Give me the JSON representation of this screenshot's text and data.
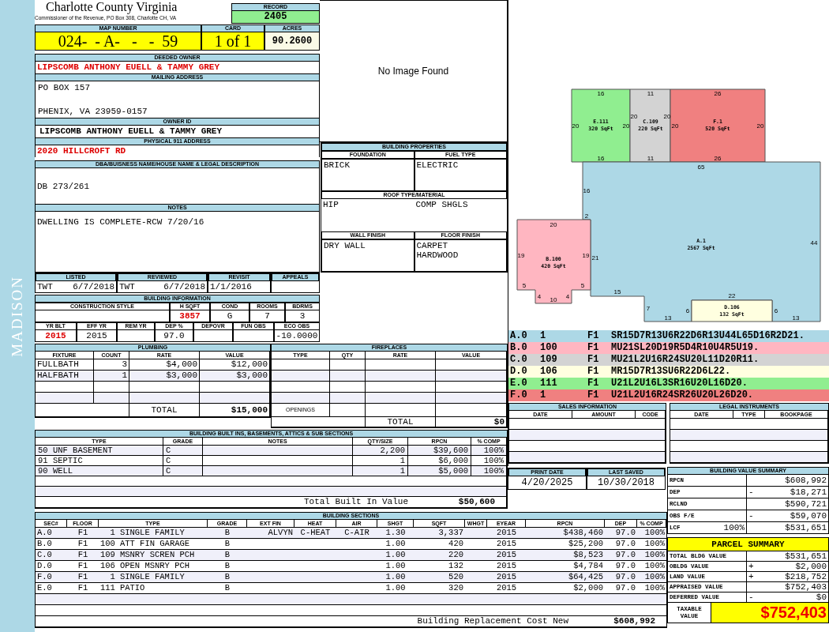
{
  "sidebar": {
    "label": "MADISON"
  },
  "header": {
    "title": "Charlotte County Virginia",
    "subtitle": "Commissioner of the Revenue, PO Box 308, Charlotte CH, VA"
  },
  "record": {
    "label": "RECORD",
    "value": "2405"
  },
  "map_number": {
    "label": "MAP NUMBER",
    "value": "024-  - A-   -   -  59"
  },
  "card": {
    "label": "CARD",
    "value": "1 of 1"
  },
  "acres": {
    "label": "ACRES",
    "value": "90.2600"
  },
  "deeded_owner": {
    "label": "DEEDED OWNER",
    "value": "LIPSCOMB ANTHONY EUELL & TAMMY GREY"
  },
  "mailing_address": {
    "label": "MAILING ADDRESS",
    "lines": [
      "PO BOX 157",
      "PHENIX, VA 23959-0157"
    ]
  },
  "owner_id": {
    "label": "OWNER ID",
    "value": "LIPSCOMB ANTHONY EUELL & TAMMY GREY"
  },
  "physical_address": {
    "label": "PHYSICAL 911 ADDRESS",
    "value": "2020 HILLCROFT RD"
  },
  "legal_description": {
    "label": "DBA/BUISNESS NAME/HOUSE NAME & LEGAL DESCRIPTION",
    "value": "DB 273/261"
  },
  "notes": {
    "label": "NOTES",
    "value": "DWELLING IS COMPLETE-RCW 7/20/16"
  },
  "photo": {
    "message": "No Image Found"
  },
  "building_properties": {
    "title": "BUILDING PROPERTIES",
    "foundation": {
      "label": "FOUNDATION",
      "value": "BRICK"
    },
    "fuel_type": {
      "label": "FUEL TYPE",
      "value": "ELECTRIC"
    },
    "roof": {
      "label": "ROOF TYPE/MATERIAL",
      "values": [
        "HIP",
        "COMP SHGLS"
      ]
    },
    "wall_finish": {
      "label": "WALL FINISH",
      "value": "DRY WALL"
    },
    "floor_finish": {
      "label": "FLOOR FINISH",
      "lines": [
        "CARPET",
        "HARDWOOD"
      ]
    }
  },
  "review": [
    {
      "label": "LISTED",
      "values": [
        "TWT",
        "6/7/2018"
      ]
    },
    {
      "label": "REVIEWED",
      "values": [
        "TWT",
        "6/7/2018"
      ]
    },
    {
      "label": "REVISIT",
      "values": [
        "1/1/2016"
      ]
    },
    {
      "label": "APPEALS"
    }
  ],
  "building_information": {
    "title": "BUILDING INFORMATION",
    "row1": [
      {
        "label": "CONSTRUCTION STYLE"
      },
      {
        "label": "H SQFT",
        "value": "3857",
        "highlight": true
      },
      {
        "label": "COND",
        "value": "G",
        "highlight": false
      },
      {
        "label": "ROOMS",
        "value": "7",
        "highlight": false
      },
      {
        "label": "BDRMS",
        "value": "3",
        "highlight": false
      }
    ],
    "row2": [
      {
        "label": "YR BLT",
        "value": "2015",
        "highlight": true
      },
      {
        "label": "EFF YR",
        "value": "2015",
        "highlight": false
      },
      {
        "label": "REM YR"
      },
      {
        "label": "DEP %",
        "value": "97.0",
        "highlight": false
      },
      {
        "label": "DEPOVR"
      },
      {
        "label": "FUN OBS"
      },
      {
        "label": "ECO OBS",
        "value": "-10.0000",
        "highlight": false
      }
    ]
  },
  "plumbing": {
    "title": "PLUMBING",
    "columns": [
      "FIXTURE",
      "COUNT",
      "RATE",
      "VALUE"
    ],
    "rows": [
      {
        "fixture": "FULLBATH",
        "count": "3",
        "rate": "$4,000",
        "value": "$12,000"
      },
      {
        "fixture": "HALFBATH",
        "count": "1",
        "rate": "$3,000",
        "value": "$3,000"
      }
    ],
    "total_label": "TOTAL",
    "total": "$15,000"
  },
  "fireplaces": {
    "title": "FIREPLACES",
    "columns": [
      "TYPE",
      "QTY",
      "RATE",
      "VALUE"
    ],
    "openings_label": "OPENINGS",
    "total_label": "TOTAL",
    "total": "$0"
  },
  "built_ins": {
    "title": "BUILDING BUILT INS, BASEMENTS, ATTICS & SUB SECTIONS",
    "columns": [
      "TYPE",
      "GRADE",
      "NOTES",
      "QTY/SIZE",
      "RPCN",
      "% COMP"
    ],
    "rows": [
      {
        "type": "50 UNF BASEMENT",
        "grade": "C",
        "qty": "2,200",
        "rpcn": "$39,600",
        "comp": "100%"
      },
      {
        "type": "91 SEPTIC",
        "grade": "C",
        "qty": "1",
        "rpcn": "$6,000",
        "comp": "100%"
      },
      {
        "type": "90 WELL",
        "grade": "C",
        "qty": "1",
        "rpcn": "$5,000",
        "comp": "100%"
      }
    ],
    "total_label": "Total Built In Value",
    "total": "$50,600"
  },
  "building_sections": {
    "title": "BUILDING SECTIONS",
    "columns": [
      "SEC#",
      "FLOOR",
      "TYPE",
      "GRADE",
      "EXT FIN",
      "HEAT",
      "AIR",
      "SHGT",
      "SQFT",
      "WHGT",
      "EYEAR",
      "RPCN",
      "DEP",
      "% COMP"
    ],
    "rows": [
      {
        "sec": "A.0",
        "floor": "F1",
        "code": "1",
        "type": "SINGLE FAMILY",
        "grade": "B",
        "ext_fin": "ALVYN",
        "heat": "C-HEAT",
        "air": "C-AIR",
        "shgt": "1.30",
        "sqft": "3,337",
        "eyear": "2015",
        "rpcn": "$438,460",
        "dep": "97.0",
        "comp": "100%"
      },
      {
        "sec": "B.0",
        "floor": "F1",
        "code": "100",
        "type": "ATT FIN GARAGE",
        "grade": "B",
        "shgt": "1.00",
        "sqft": "420",
        "eyear": "2015",
        "rpcn": "$25,200",
        "dep": "97.0",
        "comp": "100%"
      },
      {
        "sec": "C.0",
        "floor": "F1",
        "code": "109",
        "type": "MSNRY SCREN PCH",
        "grade": "B",
        "shgt": "1.00",
        "sqft": "220",
        "eyear": "2015",
        "rpcn": "$8,523",
        "dep": "97.0",
        "comp": "100%"
      },
      {
        "sec": "D.0",
        "floor": "F1",
        "code": "106",
        "type": "OPEN MSNRY PCH",
        "grade": "B",
        "shgt": "1.00",
        "sqft": "132",
        "eyear": "2015",
        "rpcn": "$4,784",
        "dep": "97.0",
        "comp": "100%"
      },
      {
        "sec": "F.0",
        "floor": "F1",
        "code": "1",
        "type": "SINGLE FAMILY",
        "grade": "B",
        "shgt": "1.00",
        "sqft": "520",
        "eyear": "2015",
        "rpcn": "$64,425",
        "dep": "97.0",
        "comp": "100%"
      },
      {
        "sec": "E.0",
        "floor": "F1",
        "code": "111",
        "type": "PATIO",
        "grade": "B",
        "shgt": "1.00",
        "sqft": "320",
        "eyear": "2015",
        "rpcn": "$2,000",
        "dep": "97.0",
        "comp": "100%"
      }
    ],
    "total_label": "Building Replacement Cost New",
    "total": "$608,992"
  },
  "sketch": {
    "areas": [
      {
        "label": "E.111",
        "sqft": "320 SqFt",
        "color": "#90ee90",
        "dims": [
          "16",
          "16",
          "20",
          "20"
        ]
      },
      {
        "label": "C.109",
        "sqft": "220 SqFt",
        "color": "#d3d3d3",
        "dims": [
          "11",
          "11",
          "20",
          "20"
        ]
      },
      {
        "label": "F.1",
        "sqft": "520 SqFt",
        "color": "#f08080",
        "dims": [
          "26",
          "26",
          "20",
          "20"
        ]
      },
      {
        "label": "A.1",
        "sqft": "2567 SqFt",
        "color": "#add8e6",
        "dims": [
          "65",
          "16",
          "2",
          "21",
          "15",
          "7",
          "13",
          "6",
          "22",
          "6",
          "13",
          "44"
        ]
      },
      {
        "label": "B.100",
        "sqft": "420 SqFt",
        "color": "#ffb6c1",
        "dims": [
          "20",
          "19",
          "19",
          "5",
          "4",
          "10",
          "4",
          "5"
        ]
      },
      {
        "label": "D.106",
        "sqft": "132 SqFt",
        "color": "#ffffe0"
      }
    ]
  },
  "segments": [
    {
      "sec": "A.0",
      "code": "1",
      "floor": "F1",
      "path": "SR15D7R13U6R22D6R13U44L65D16R2D21.",
      "color": "#add8e6"
    },
    {
      "sec": "B.0",
      "code": "100",
      "floor": "F1",
      "path": "MU21SL20D19R5D4R10U4R5U19.",
      "color": "#ffb6c1"
    },
    {
      "sec": "C.0",
      "code": "109",
      "floor": "F1",
      "path": "MU21L2U16R24SU20L11D20R11.",
      "color": "#d3d3d3"
    },
    {
      "sec": "D.0",
      "code": "106",
      "floor": "F1",
      "path": "MR15D7R13SU6R22D6L22.",
      "color": "#ffffe0"
    },
    {
      "sec": "E.0",
      "code": "111",
      "floor": "F1",
      "path": "U21L2U16L3SR16U20L16D20.",
      "color": "#90ee90"
    },
    {
      "sec": "F.0",
      "code": "1",
      "floor": "F1",
      "path": "U21L2U16R24SR26U20L26D20.",
      "color": "#f08080"
    }
  ],
  "sales": {
    "title": "SALES INFORMATION",
    "columns": [
      "DATE",
      "AMOUNT",
      "CODE"
    ]
  },
  "legal_instruments": {
    "title": "LEGAL INSTRUMENTS",
    "columns": [
      "DATE",
      "TYPE",
      "BOOKPAGE"
    ]
  },
  "print_date": {
    "label": "PRINT DATE",
    "value": "4/20/2025"
  },
  "last_saved": {
    "label": "LAST SAVED",
    "value": "10/30/2018"
  },
  "building_value_summary": {
    "title": "BUILDING VALUE SUMMARY",
    "rows": [
      {
        "label": "RPCN",
        "value": "$608,992"
      },
      {
        "label": "DEP",
        "sign": "-",
        "value": "$18,271"
      },
      {
        "label": "RCLND",
        "value": "$590,721"
      },
      {
        "label": "OBS F/E",
        "sign": "-",
        "value": "$59,070"
      },
      {
        "label": "LCF",
        "pct": "100%",
        "value": "$531,651"
      }
    ]
  },
  "parcel_summary": {
    "title": "PARCEL SUMMARY",
    "rows": [
      {
        "label": "TOTAL BLDG VALUE",
        "value": "$531,651"
      },
      {
        "label": "OBLDG VALUE",
        "sign": "+",
        "value": "$2,000"
      },
      {
        "label": "LAND VALUE",
        "sign": "+",
        "value": "$218,752"
      },
      {
        "label": "APPRAISED VALUE",
        "value": "$752,403"
      },
      {
        "label": "DEFERRED VALUE",
        "sign": "-",
        "value": "$0"
      }
    ],
    "taxable_label": "TAXABLE VALUE",
    "taxable": "$752,403"
  }
}
